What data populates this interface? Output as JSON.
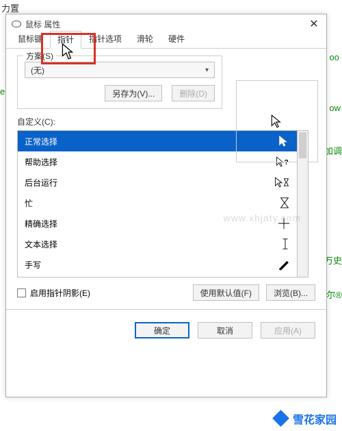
{
  "bg_fragments": {
    "a": "力置",
    "b": "oo",
    "c": "ek",
    "d": "ow",
    "e": "加调",
    "f": "万史",
    "g": "尔®"
  },
  "dialog": {
    "title": "鼠标 属性",
    "tabs": [
      "鼠标键",
      "指针",
      "指针选项",
      "滑轮",
      "硬件"
    ],
    "active_tab_index": 1,
    "scheme": {
      "legend": "方案(S)",
      "value": "(无)",
      "save_as": "另存为(V)...",
      "delete": "删除(D)"
    },
    "custom_label": "自定义(C):",
    "cursor_rows": [
      {
        "name": "正常选择",
        "icon": "arrow",
        "selected": true
      },
      {
        "name": "帮助选择",
        "icon": "arrow-help",
        "selected": false
      },
      {
        "name": "后台运行",
        "icon": "arrow-hourglass",
        "selected": false
      },
      {
        "name": "忙",
        "icon": "hourglass",
        "selected": false
      },
      {
        "name": "精确选择",
        "icon": "crosshair",
        "selected": false
      },
      {
        "name": "文本选择",
        "icon": "ibeam",
        "selected": false
      },
      {
        "name": "手写",
        "icon": "pen",
        "selected": false
      }
    ],
    "shadow_checkbox": "启用指针阴影(E)",
    "use_default": "使用默认值(F)",
    "browse": "浏览(B)...",
    "ok": "确定",
    "cancel": "取消",
    "apply": "应用(A)"
  },
  "watermark": "www.xhjaty.com",
  "brand": "雪花家园"
}
